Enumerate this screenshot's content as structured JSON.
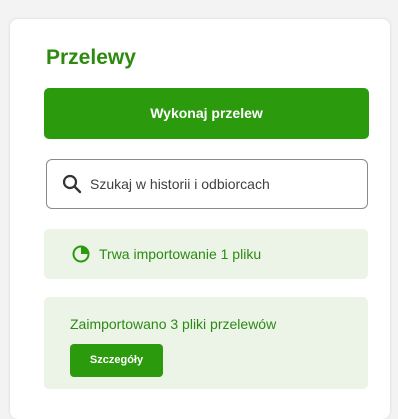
{
  "panel": {
    "title": "Przelewy",
    "primary_action_label": "Wykonaj przelew"
  },
  "search": {
    "placeholder": "Szukaj w historii i odbiorcach",
    "icon": "search-icon"
  },
  "import_status": {
    "icon": "progress-pie-icon",
    "text": "Trwa importowanie 1 pliku",
    "progress_fraction": 0.25
  },
  "import_result": {
    "text": "Zaimportowano 3 pliki przelewów",
    "details_label": "Szczegóły"
  },
  "colors": {
    "brand_green": "#2b9a0d",
    "text_green": "#2c8a13",
    "light_green_bg": "#ebf4e7"
  }
}
